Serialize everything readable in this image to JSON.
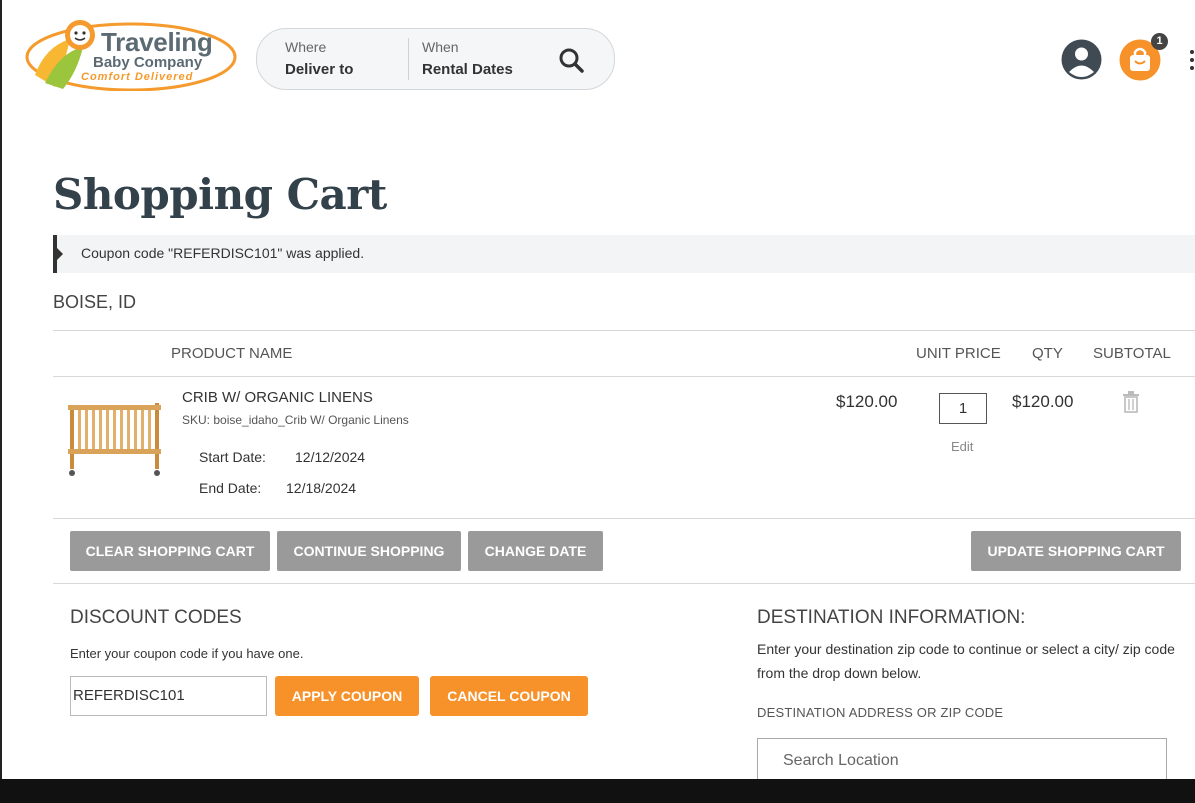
{
  "header": {
    "logo": {
      "line1": "Traveling",
      "line2": "Baby Company",
      "tagline": "Comfort Delivered"
    },
    "search": {
      "where_label": "Where",
      "where_value": "Deliver to",
      "when_label": "When",
      "when_value": "Rental Dates",
      "icon": "search-icon"
    },
    "account_icon": "user-icon",
    "cart": {
      "icon": "shopping-bag-icon",
      "count": "1"
    },
    "menu_icon": "kebab-menu-icon"
  },
  "page": {
    "title": "Shopping Cart",
    "notice": "Coupon code \"REFERDISC101\" was applied.",
    "location": "BOISE, ID"
  },
  "cart": {
    "columns": {
      "product": "PRODUCT NAME",
      "unit_price": "UNIT PRICE",
      "qty": "QTY",
      "subtotal": "SUBTOTAL"
    },
    "items": [
      {
        "name": "CRIB W/ ORGANIC LINENS",
        "sku": "SKU: boise_idaho_Crib W/ Organic Linens",
        "start_label": "Start Date:",
        "start_date": "12/12/2024",
        "end_label": "End Date:",
        "end_date": "12/18/2024",
        "unit_price": "$120.00",
        "qty": "1",
        "edit_label": "Edit",
        "subtotal": "$120.00"
      }
    ],
    "buttons": {
      "clear": "CLEAR SHOPPING CART",
      "continue": "CONTINUE SHOPPING",
      "change_date": "CHANGE DATE",
      "update": "UPDATE SHOPPING CART"
    }
  },
  "discount": {
    "title": "DISCOUNT CODES",
    "hint": "Enter your coupon code if you have one.",
    "code_value": "REFERDISC101",
    "apply_label": "APPLY COUPON",
    "cancel_label": "CANCEL COUPON"
  },
  "destination": {
    "title": "DESTINATION INFORMATION:",
    "description": "Enter your destination zip code to continue or select a city/ zip code from the drop down below.",
    "field_label": "DESTINATION ADDRESS OR ZIP CODE",
    "placeholder": "Search Location"
  },
  "colors": {
    "accent": "#f7922a",
    "button_gray": "#9a9a9a",
    "title": "#33414b"
  }
}
